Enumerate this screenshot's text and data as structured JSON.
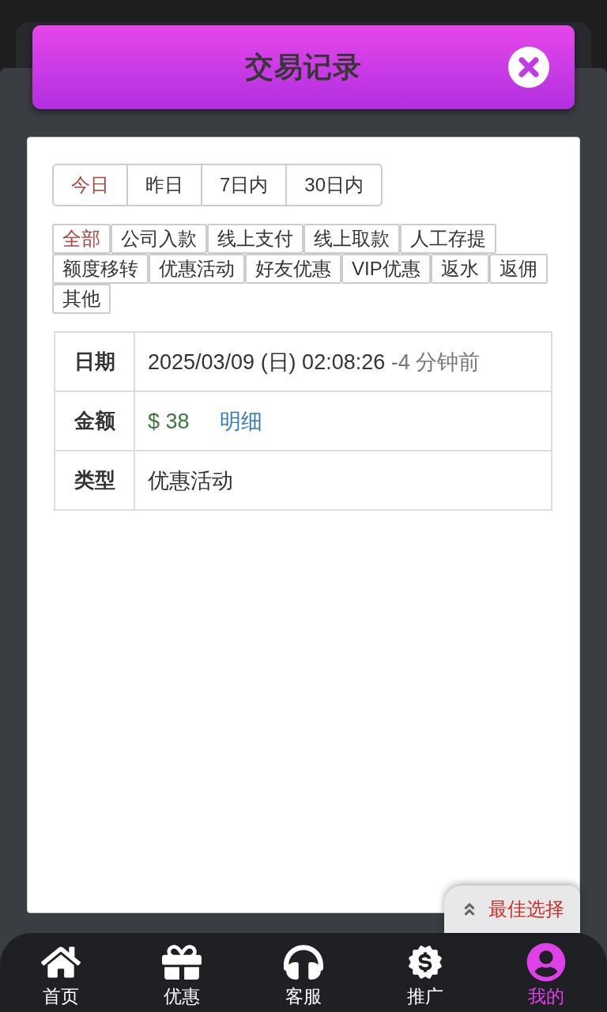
{
  "header": {
    "title": "交易记录"
  },
  "date_tabs": [
    {
      "label": "今日",
      "selected": true
    },
    {
      "label": "昨日",
      "selected": false
    },
    {
      "label": "7日内",
      "selected": false
    },
    {
      "label": "30日内",
      "selected": false
    }
  ],
  "categories": [
    {
      "label": "全部",
      "selected": true
    },
    {
      "label": "公司入款",
      "selected": false
    },
    {
      "label": "线上支付",
      "selected": false
    },
    {
      "label": "线上取款",
      "selected": false
    },
    {
      "label": "人工存提",
      "selected": false
    },
    {
      "label": "额度移转",
      "selected": false
    },
    {
      "label": "优惠活动",
      "selected": false
    },
    {
      "label": "好友优惠",
      "selected": false
    },
    {
      "label": "VIP优惠",
      "selected": false
    },
    {
      "label": "返水",
      "selected": false
    },
    {
      "label": "返佣",
      "selected": false
    },
    {
      "label": "其他",
      "selected": false
    }
  ],
  "details": [
    {
      "kind": "date",
      "label": "日期",
      "value": "2025/03/09 (日) 02:08:26",
      "relative": "-4 分钟前"
    },
    {
      "kind": "amount",
      "label": "金额",
      "value": "$ 38",
      "link": "明细"
    },
    {
      "kind": "text",
      "label": "类型",
      "value": "优惠活动"
    }
  ],
  "float_button": {
    "label": "最佳选择"
  },
  "nav": [
    {
      "label": "首页",
      "selected": false
    },
    {
      "label": "优惠",
      "selected": false
    },
    {
      "label": "客服",
      "selected": false
    },
    {
      "label": "推广",
      "selected": false
    },
    {
      "label": "我的",
      "selected": true
    }
  ]
}
